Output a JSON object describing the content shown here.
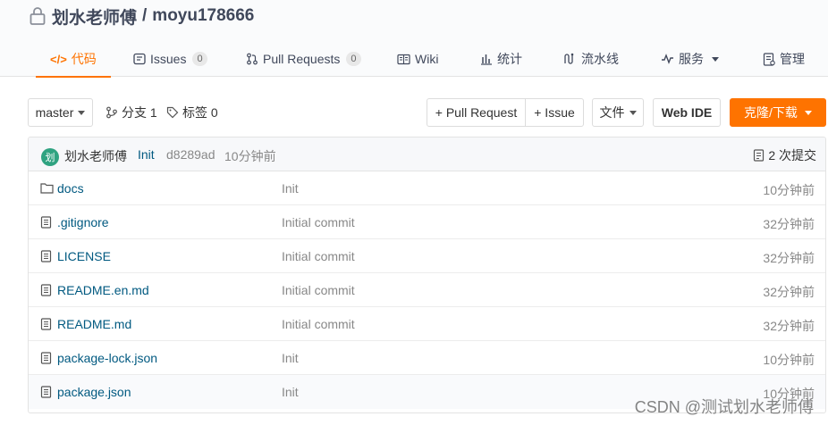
{
  "repo": {
    "owner": "划水老师傅",
    "separator": "/",
    "name": "moyu178666"
  },
  "tabs": [
    {
      "label": "代码",
      "icon": "code-icon",
      "active": true
    },
    {
      "label": "Issues",
      "count": "0",
      "icon": "issues-icon"
    },
    {
      "label": "Pull Requests",
      "count": "0",
      "icon": "pull-request-icon"
    },
    {
      "label": "Wiki",
      "icon": "wiki-icon"
    },
    {
      "label": "统计",
      "icon": "stats-icon"
    },
    {
      "label": "流水线",
      "icon": "pipeline-icon"
    },
    {
      "label": "服务",
      "icon": "service-icon"
    },
    {
      "label": "管理",
      "icon": "manage-icon"
    }
  ],
  "toolbar": {
    "branch": "master",
    "branches": "分支 1",
    "tags": "标签 0",
    "new_pr": "+ Pull Request",
    "new_issue": "+ Issue",
    "file_menu": "文件",
    "web_ide": "Web IDE",
    "clone": "克隆/下载"
  },
  "commit": {
    "avatar_text": "划",
    "author": "划水老师傅",
    "message": "Init",
    "sha": "d8289ad",
    "time": "10分钟前",
    "count": "2 次提交"
  },
  "files": [
    {
      "name": "docs",
      "type": "folder",
      "message": "Init",
      "time": "10分钟前"
    },
    {
      "name": ".gitignore",
      "type": "file",
      "message": "Initial commit",
      "time": "32分钟前"
    },
    {
      "name": "LICENSE",
      "type": "file",
      "message": "Initial commit",
      "time": "32分钟前"
    },
    {
      "name": "README.en.md",
      "type": "file",
      "message": "Initial commit",
      "time": "32分钟前"
    },
    {
      "name": "README.md",
      "type": "file",
      "message": "Initial commit",
      "time": "32分钟前"
    },
    {
      "name": "package-lock.json",
      "type": "file",
      "message": "Init",
      "time": "10分钟前"
    },
    {
      "name": "package.json",
      "type": "file",
      "message": "Init",
      "time": "10分钟前"
    }
  ],
  "watermark": "CSDN @测试划水老师傅",
  "colors": {
    "accent": "#fe7300",
    "link": "#005980",
    "muted": "#888888"
  }
}
